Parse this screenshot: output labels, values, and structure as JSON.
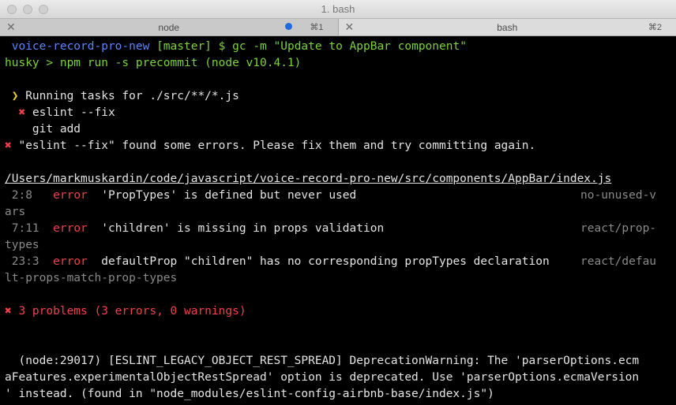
{
  "window": {
    "title": "1. bash"
  },
  "tabs": [
    {
      "close": "✕",
      "label": "node",
      "shortcut": "⌘1"
    },
    {
      "close": "✕",
      "label": "bash",
      "shortcut": "⌘2"
    }
  ],
  "terminal": {
    "prompt": {
      "dir": "voice-record-pro-new",
      "branch": "[master]",
      "symbol": "$",
      "command": "gc -m \"Update to AppBar component\""
    },
    "husky_line": "husky > npm run -s precommit (node v10.4.1)",
    "running_prefix": "❯",
    "running_text": "Running tasks for ./src/**/*.js",
    "task1_mark": "✖",
    "task1": "eslint --fix",
    "task2": "git add",
    "fail_mark": "✖",
    "fail_text": "\"eslint --fix\" found some errors. Please fix them and try committing again.",
    "file_path": "/Users/markmuskardin/code/javascript/voice-record-pro-new/src/components/AppBar/index.js",
    "problems": [
      {
        "pos": " 2:8 ",
        "level": "error",
        "msg": "'PropTypes' is defined but never used",
        "rule_a": "no-unused-v",
        "rule_b": "ars"
      },
      {
        "pos": " 7:11",
        "level": "error",
        "msg": "'children' is missing in props validation",
        "rule_a": "react/prop-",
        "rule_b": "types"
      },
      {
        "pos": " 23:3",
        "level": "error",
        "msg": "defaultProp \"children\" has no corresponding propTypes declaration",
        "rule_a": "react/defau",
        "rule_b": "lt-props-match-prop-types"
      }
    ],
    "summary_mark": "✖",
    "summary": "3 problems (3 errors, 0 warnings)",
    "warning_lines": [
      "  (node:29017) [ESLINT_LEGACY_OBJECT_REST_SPREAD] DeprecationWarning: The 'parserOptions.ecm",
      "aFeatures.experimentalObjectRestSpread' option is deprecated. Use 'parserOptions.ecmaVersion",
      "' instead. (found in \"node_modules/eslint-config-airbnb-base/index.js\")"
    ]
  }
}
